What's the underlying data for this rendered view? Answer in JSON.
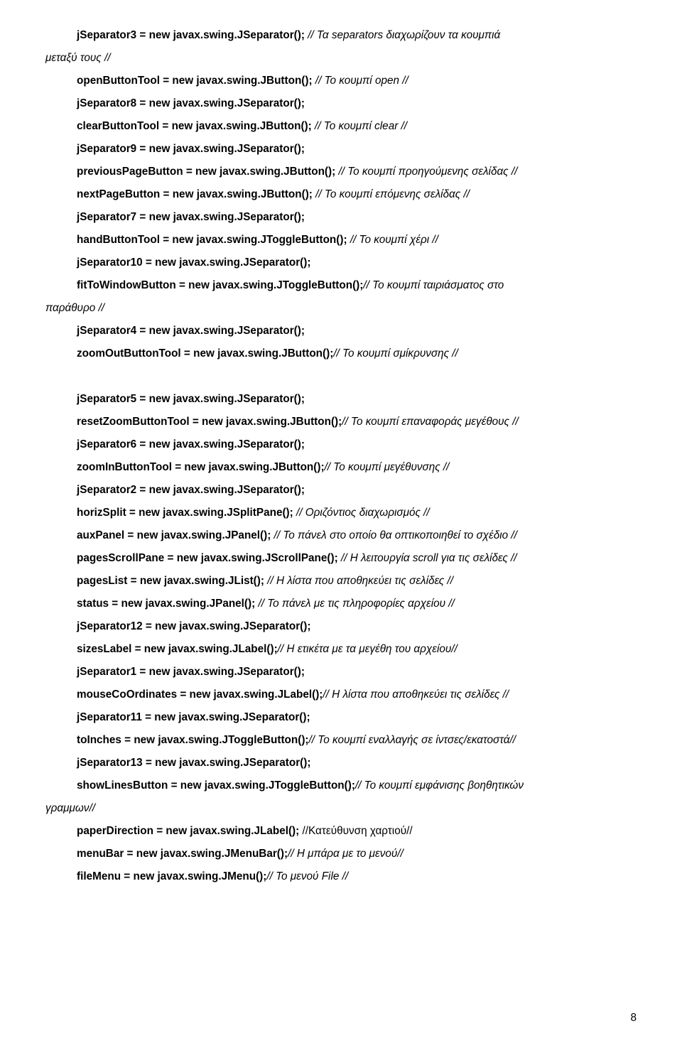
{
  "lines": [
    {
      "segments": [
        {
          "text": "jSeparator3 = new javax.swing.JSeparator(); ",
          "bold": true
        },
        {
          "text": "// Τα separators διαχωρίζουν τα κουμπιά ",
          "italic": true
        }
      ],
      "indent": true
    },
    {
      "segments": [
        {
          "text": "μεταξύ τους //",
          "italic": true
        }
      ],
      "indent": false
    },
    {
      "segments": [
        {
          "text": "openButtonTool = new javax.swing.JButton(); ",
          "bold": true
        },
        {
          "text": "// Το κουμπί open //",
          "italic": true
        }
      ],
      "indent": true
    },
    {
      "segments": [
        {
          "text": "jSeparator8 = new javax.swing.JSeparator();",
          "bold": true
        }
      ],
      "indent": true
    },
    {
      "segments": [
        {
          "text": "clearButtonTool = new javax.swing.JButton(); ",
          "bold": true
        },
        {
          "text": "// Το κουμπί clear //",
          "italic": true
        }
      ],
      "indent": true
    },
    {
      "segments": [
        {
          "text": "jSeparator9 = new javax.swing.JSeparator();",
          "bold": true
        }
      ],
      "indent": true
    },
    {
      "segments": [
        {
          "text": "previousPageButton = new javax.swing.JButton(); ",
          "bold": true
        },
        {
          "text": "// Το κουμπί προηγούμενης σελίδας //",
          "italic": true
        }
      ],
      "indent": true
    },
    {
      "segments": [
        {
          "text": "nextPageButton = new javax.swing.JButton(); ",
          "bold": true
        },
        {
          "text": "// Το κουμπί επόμενης σελίδας //",
          "italic": true
        }
      ],
      "indent": true
    },
    {
      "segments": [
        {
          "text": "jSeparator7 = new javax.swing.JSeparator();",
          "bold": true
        }
      ],
      "indent": true
    },
    {
      "segments": [
        {
          "text": "handButtonTool = new javax.swing.JToggleButton(); ",
          "bold": true
        },
        {
          "text": "// Το κουμπί χέρι //",
          "italic": true
        }
      ],
      "indent": true
    },
    {
      "segments": [
        {
          "text": "jSeparator10 = new javax.swing.JSeparator();",
          "bold": true
        }
      ],
      "indent": true
    },
    {
      "segments": [
        {
          "text": "fitToWindowButton  =  new  javax.swing.JToggleButton();",
          "bold": true
        },
        {
          "text": "//  Το  κουμπί  ταιριάσματος  στο ",
          "italic": true
        }
      ],
      "indent": true
    },
    {
      "segments": [
        {
          "text": "παράθυρο //",
          "italic": true
        }
      ],
      "indent": false
    },
    {
      "segments": [
        {
          "text": "jSeparator4 = new javax.swing.JSeparator();",
          "bold": true
        }
      ],
      "indent": true
    },
    {
      "segments": [
        {
          "text": "zoomOutButtonTool = new javax.swing.JButton();",
          "bold": true
        },
        {
          "text": "// Το κουμπί σμίκρυνσης //",
          "italic": true
        }
      ],
      "indent": true
    },
    {
      "segments": [],
      "indent": true
    },
    {
      "segments": [
        {
          "text": "jSeparator5 = new javax.swing.JSeparator();",
          "bold": true
        }
      ],
      "indent": true
    },
    {
      "segments": [
        {
          "text": "resetZoomButtonTool = new javax.swing.JButton();",
          "bold": true
        },
        {
          "text": "// Το κουμπί επαναφοράς μεγέθους //",
          "italic": true
        }
      ],
      "indent": true
    },
    {
      "segments": [
        {
          "text": "jSeparator6 = new javax.swing.JSeparator();",
          "bold": true
        }
      ],
      "indent": true
    },
    {
      "segments": [
        {
          "text": "zoomInButtonTool = new javax.swing.JButton();",
          "bold": true
        },
        {
          "text": "// Το κουμπί μεγέθυνσης //",
          "italic": true
        }
      ],
      "indent": true
    },
    {
      "segments": [
        {
          "text": "jSeparator2 = new javax.swing.JSeparator();",
          "bold": true
        }
      ],
      "indent": true
    },
    {
      "segments": [
        {
          "text": "horizSplit = new javax.swing.JSplitPane(); ",
          "bold": true
        },
        {
          "text": "// Οριζόντιος διαχωρισμός //",
          "italic": true
        }
      ],
      "indent": true
    },
    {
      "segments": [
        {
          "text": "auxPanel = new javax.swing.JPanel(); ",
          "bold": true
        },
        {
          "text": "// Το πάνελ στο οποίο θα οπτικοποιηθεί το σχέδιο //",
          "italic": true
        }
      ],
      "indent": true
    },
    {
      "segments": [
        {
          "text": "pagesScrollPane = new javax.swing.JScrollPane(); ",
          "bold": true
        },
        {
          "text": "// Η λειτουργία scroll για τις σελίδες //",
          "italic": true
        }
      ],
      "indent": true
    },
    {
      "segments": [
        {
          "text": "pagesList = new javax.swing.JList(); ",
          "bold": true
        },
        {
          "text": "// Η λίστα που αποθηκεύει τις σελίδες //",
          "italic": true
        }
      ],
      "indent": true
    },
    {
      "segments": [
        {
          "text": "status = new javax.swing.JPanel(); ",
          "bold": true
        },
        {
          "text": "// Το πάνελ με τις πληροφορίες αρχείου //",
          "italic": true
        }
      ],
      "indent": true
    },
    {
      "segments": [
        {
          "text": "jSeparator12 = new javax.swing.JSeparator();",
          "bold": true
        }
      ],
      "indent": true
    },
    {
      "segments": [
        {
          "text": "sizesLabel = new javax.swing.JLabel();",
          "bold": true
        },
        {
          "text": "// Η ετικέτα με τα μεγέθη του αρχείου//",
          "italic": true
        }
      ],
      "indent": true
    },
    {
      "segments": [
        {
          "text": "jSeparator1 = new javax.swing.JSeparator();",
          "bold": true
        }
      ],
      "indent": true
    },
    {
      "segments": [
        {
          "text": "mouseCoOrdinates = new javax.swing.JLabel();",
          "bold": true
        },
        {
          "text": "// Η λίστα που αποθηκεύει τις σελίδες //",
          "italic": true
        }
      ],
      "indent": true
    },
    {
      "segments": [
        {
          "text": "jSeparator11 = new javax.swing.JSeparator();",
          "bold": true
        }
      ],
      "indent": true
    },
    {
      "segments": [
        {
          "text": "toInches = new javax.swing.JToggleButton();",
          "bold": true
        },
        {
          "text": "// Το κουμπί εναλλαγής σε ίντσες/εκατοστά//",
          "italic": true
        }
      ],
      "indent": true
    },
    {
      "segments": [
        {
          "text": "jSeparator13 = new javax.swing.JSeparator();",
          "bold": true
        }
      ],
      "indent": true
    },
    {
      "segments": [
        {
          "text": "showLinesButton = new javax.swing.JToggleButton();",
          "bold": true
        },
        {
          "text": "// Το κουμπί εμφάνισης βοηθητικών ",
          "italic": true
        }
      ],
      "indent": true
    },
    {
      "segments": [
        {
          "text": "γραμμων//",
          "italic": true
        }
      ],
      "indent": false
    },
    {
      "segments": [
        {
          "text": "paperDirection = new javax.swing.JLabel(); ",
          "bold": true
        },
        {
          "text": "//Κατεύθυνση χαρτιού//"
        }
      ],
      "indent": true
    },
    {
      "segments": [
        {
          "text": "menuBar = new javax.swing.JMenuBar();",
          "bold": true
        },
        {
          "text": "// Η μπάρα με το μενού//",
          "italic": true
        }
      ],
      "indent": true
    },
    {
      "segments": [
        {
          "text": "fileMenu = new javax.swing.JMenu();",
          "bold": true
        },
        {
          "text": "// Το μενού File //",
          "italic": true
        }
      ],
      "indent": true
    }
  ],
  "page_number": "8"
}
